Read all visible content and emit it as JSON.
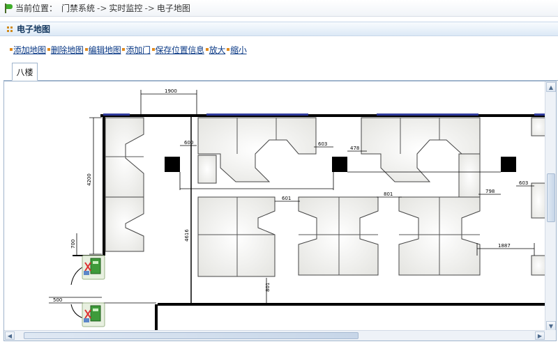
{
  "breadcrumb": {
    "prefix": "当前位置：",
    "items": [
      "门禁系统",
      "实时监控",
      "电子地图"
    ],
    "separator": "->"
  },
  "panel": {
    "title": "电子地图"
  },
  "toolbar": {
    "items": [
      "添加地图",
      "删除地图",
      "编辑地图",
      "添加门",
      "保存位置信息",
      "放大",
      "缩小"
    ]
  },
  "tabs": [
    {
      "label": "八楼",
      "active": true
    }
  ],
  "map": {
    "dimensions": [
      "1900",
      "4200",
      "700",
      "600",
      "603",
      "478",
      "4616",
      "601",
      "801",
      "798",
      "603",
      "1887",
      "801",
      "500"
    ],
    "door_icons": [
      "door-reader-icon",
      "door-reader-icon"
    ]
  },
  "scrollbars": {
    "up": "▲",
    "down": "▼",
    "left": "◀",
    "right": "▶"
  },
  "colors": {
    "link": "#0b3a86",
    "header_text": "#12365e",
    "accent_dot": "#e08a1e",
    "window_blue": "#2f3a9c"
  }
}
